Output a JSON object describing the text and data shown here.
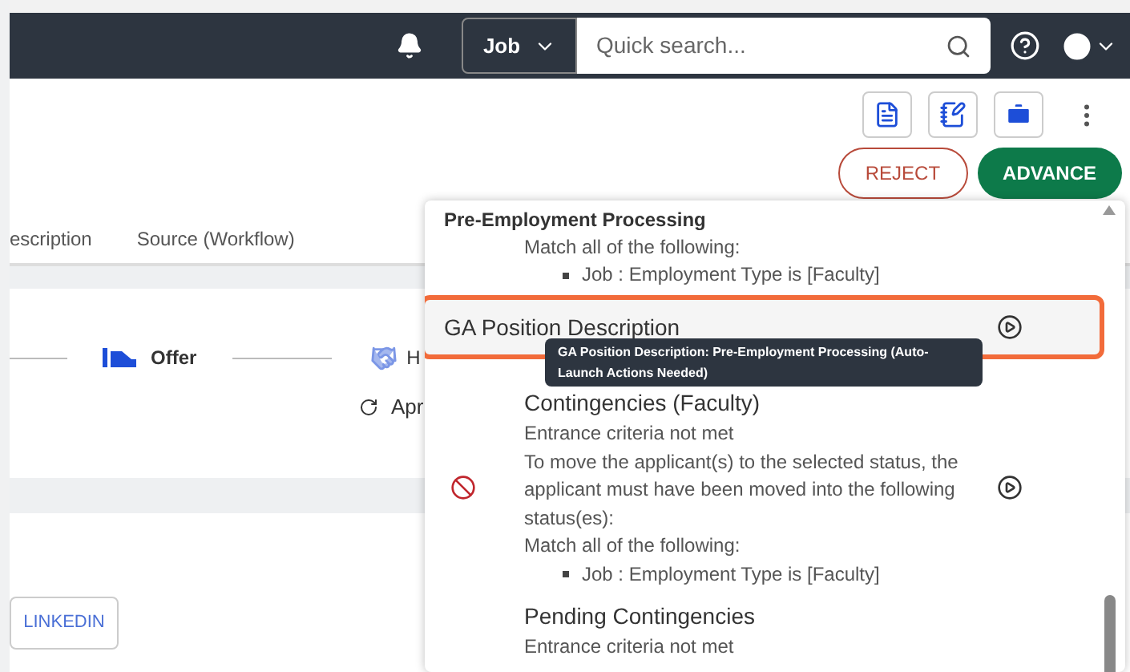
{
  "topbar": {
    "search_scope": "Job",
    "search": {
      "placeholder": "Quick search..."
    }
  },
  "actions": {
    "reject": "REJECT",
    "advance": "ADVANCE"
  },
  "tabs": [
    {
      "label": "escription",
      "selected": false
    },
    {
      "label": "Source (Workflow)",
      "selected": false
    }
  ],
  "workflow": {
    "steps": [
      {
        "label": "Offer"
      },
      {
        "label": "H"
      }
    ],
    "date": "Apr"
  },
  "social_button": "LINKEDIN",
  "status_menu": {
    "items": [
      {
        "kind": "heading",
        "title": "Pre-Employment Processing",
        "lines": [
          "Match all of the following:"
        ],
        "bullets": [
          "Job : Employment Type is [Faculty]"
        ]
      },
      {
        "kind": "status",
        "title": "GA Position Description",
        "selected": true,
        "blocked": false
      },
      {
        "kind": "status",
        "title": "Contingencies (Faculty)",
        "selected": false,
        "blocked": true,
        "lines": [
          "Entrance criteria not met",
          "To move the applicant(s) to the selected status, the applicant must have been moved into the following status(es):",
          "Match all of the following:"
        ],
        "bullets": [
          "Job : Employment Type is [Faculty]"
        ]
      },
      {
        "kind": "status",
        "title": "Pending Contingencies",
        "selected": false,
        "blocked": false,
        "lines": [
          "Entrance criteria not met"
        ]
      }
    ],
    "tooltip": "GA Position Description: Pre-Employment Processing (Auto-Launch Actions Needed)"
  }
}
